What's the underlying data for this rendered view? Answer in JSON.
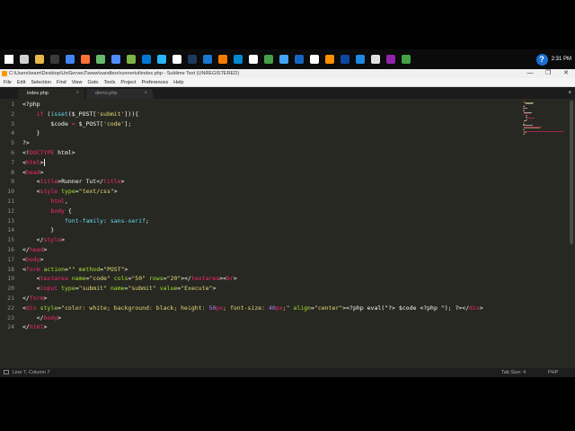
{
  "window": {
    "title": "C:\\Users\\team\\Desktop\\UniServerZ\\www\\sandbox\\runnertut\\index.php - Sublime Text (UNREGISTERED)",
    "controls": [
      "—",
      "❐",
      "✕"
    ]
  },
  "taskbar": {
    "icons": [
      "windows-icon",
      "task-view-icon",
      "file-explorer-icon",
      "terminal-icon",
      "chrome-icon",
      "firefox-icon",
      "app-icon",
      "app-icon",
      "app-icon",
      "app-icon",
      "app-icon",
      "app-icon",
      "steam-icon",
      "app-icon",
      "app-icon",
      "app-icon",
      "app-icon",
      "app-icon",
      "app-icon",
      "app-icon",
      "app-icon",
      "vlc-icon",
      "app-icon",
      "app-icon",
      "app-icon",
      "app-icon",
      "app-icon"
    ],
    "icon_colors": [
      "#ffffff",
      "#d0d0d0",
      "#e8b84a",
      "#3a3a3a",
      "#4285f4",
      "#ff7139",
      "#66bb6a",
      "#4e8cff",
      "#7cb342",
      "#0078d7",
      "#29b6f6",
      "#ffffff",
      "#1e3a5f",
      "#1976d2",
      "#f57c00",
      "#0288d1",
      "#ffffff",
      "#43a047",
      "#42a5f5",
      "#1565c0",
      "#ffffff",
      "#ff8f00",
      "#0d47a1",
      "#1e88e5",
      "#e0e0e0",
      "#8e24aa",
      "#43a047"
    ],
    "tray_time": "2:31 PM"
  },
  "menu": {
    "items": [
      "File",
      "Edit",
      "Selection",
      "Find",
      "View",
      "Goto",
      "Tools",
      "Project",
      "Preferences",
      "Help"
    ]
  },
  "tabs": [
    {
      "label": "index.php",
      "active": true
    },
    {
      "label": "demo.php",
      "active": false
    }
  ],
  "editor": {
    "line_numbers": [
      "1",
      "2",
      "3",
      "4",
      "5",
      "6",
      "7",
      "8",
      "9",
      "10",
      "11",
      "12",
      "13",
      "14",
      "15",
      "16",
      "17",
      "18",
      "19",
      "20",
      "21",
      "22",
      "23",
      "24"
    ],
    "lines": [
      [
        [
          "t",
          "<?php"
        ]
      ],
      [
        [
          "t",
          "    "
        ],
        [
          "k",
          "if"
        ],
        [
          "t",
          " ("
        ],
        [
          "v",
          "isset"
        ],
        [
          "t",
          "($_POST["
        ],
        [
          "s",
          "'submit'"
        ],
        [
          "t",
          "])){"
        ]
      ],
      [
        [
          "t",
          "        $code "
        ],
        [
          "k",
          "="
        ],
        [
          "t",
          " $_POST["
        ],
        [
          "s",
          "'code'"
        ],
        [
          "t",
          "];"
        ]
      ],
      [
        [
          "t",
          "    }"
        ]
      ],
      [
        [
          "t",
          "?>"
        ]
      ],
      [
        [
          "t",
          "<!"
        ],
        [
          "k",
          "DOCTYPE"
        ],
        [
          "t",
          " html>"
        ]
      ],
      [
        [
          "t",
          "<"
        ],
        [
          "k",
          "html"
        ],
        [
          "t",
          ">"
        ],
        [
          "caret",
          ""
        ]
      ],
      [
        [
          "t",
          "<"
        ],
        [
          "k",
          "head"
        ],
        [
          "t",
          ">"
        ]
      ],
      [
        [
          "t",
          "    <"
        ],
        [
          "k",
          "title"
        ],
        [
          "t",
          ">Runner Tut</"
        ],
        [
          "k",
          "title"
        ],
        [
          "t",
          ">"
        ]
      ],
      [
        [
          "t",
          "    <"
        ],
        [
          "k",
          "style"
        ],
        [
          "t",
          " "
        ],
        [
          "a",
          "type"
        ],
        [
          "t",
          "="
        ],
        [
          "s",
          "\"text/css\""
        ],
        [
          "t",
          ">"
        ]
      ],
      [
        [
          "t",
          "        "
        ],
        [
          "k",
          "html"
        ],
        [
          "t",
          ","
        ]
      ],
      [
        [
          "t",
          "        "
        ],
        [
          "k",
          "body"
        ],
        [
          "t",
          " {"
        ]
      ],
      [
        [
          "t",
          "            "
        ],
        [
          "v",
          "font-family"
        ],
        [
          "t",
          ": "
        ],
        [
          "v",
          "sans-serif"
        ],
        [
          "t",
          ";"
        ]
      ],
      [
        [
          "t",
          "        }"
        ]
      ],
      [
        [
          "t",
          "    </"
        ],
        [
          "k",
          "style"
        ],
        [
          "t",
          ">"
        ]
      ],
      [
        [
          "t",
          "</"
        ],
        [
          "k",
          "head"
        ],
        [
          "t",
          ">"
        ]
      ],
      [
        [
          "t",
          "<"
        ],
        [
          "k",
          "body"
        ],
        [
          "t",
          ">"
        ]
      ],
      [
        [
          "t",
          "<"
        ],
        [
          "k",
          "form"
        ],
        [
          "t",
          " "
        ],
        [
          "a",
          "action"
        ],
        [
          "t",
          "="
        ],
        [
          "s",
          "\"\""
        ],
        [
          "t",
          " "
        ],
        [
          "a",
          "method"
        ],
        [
          "t",
          "="
        ],
        [
          "s",
          "\"POST\""
        ],
        [
          "t",
          ">"
        ]
      ],
      [
        [
          "t",
          "    <"
        ],
        [
          "k",
          "textarea"
        ],
        [
          "t",
          " "
        ],
        [
          "a",
          "name"
        ],
        [
          "t",
          "="
        ],
        [
          "s",
          "\"code\""
        ],
        [
          "t",
          " "
        ],
        [
          "a",
          "cols"
        ],
        [
          "t",
          "="
        ],
        [
          "s",
          "\"50\""
        ],
        [
          "t",
          " "
        ],
        [
          "a",
          "rows"
        ],
        [
          "t",
          "="
        ],
        [
          "s",
          "\"20\""
        ],
        [
          "t",
          "></"
        ],
        [
          "k",
          "textarea"
        ],
        [
          "t",
          "><"
        ],
        [
          "k",
          "br"
        ],
        [
          "t",
          ">"
        ]
      ],
      [
        [
          "t",
          "    <"
        ],
        [
          "k",
          "input"
        ],
        [
          "t",
          " "
        ],
        [
          "a",
          "type"
        ],
        [
          "t",
          "="
        ],
        [
          "s",
          "\"submit\""
        ],
        [
          "t",
          " "
        ],
        [
          "a",
          "name"
        ],
        [
          "t",
          "="
        ],
        [
          "s",
          "\"submit\""
        ],
        [
          "t",
          " "
        ],
        [
          "a",
          "value"
        ],
        [
          "t",
          "="
        ],
        [
          "s",
          "\"Execute\""
        ],
        [
          "t",
          ">"
        ]
      ],
      [
        [
          "t",
          "</"
        ],
        [
          "k",
          "form"
        ],
        [
          "t",
          ">"
        ]
      ],
      [
        [
          "t",
          "<"
        ],
        [
          "k",
          "div"
        ],
        [
          "t",
          " "
        ],
        [
          "a",
          "style"
        ],
        [
          "t",
          "="
        ],
        [
          "s",
          "\"color: white; background: black; height: "
        ],
        [
          "n",
          "50"
        ],
        [
          "k",
          "px"
        ],
        [
          "s",
          "; font-size: "
        ],
        [
          "n",
          "40"
        ],
        [
          "k",
          "px"
        ],
        [
          "s",
          ";\""
        ],
        [
          "t",
          " "
        ],
        [
          "a",
          "align"
        ],
        [
          "t",
          "="
        ],
        [
          "s",
          "\"center\""
        ],
        [
          "t",
          ">"
        ],
        [
          "t",
          "<?php eval(\"?> $code <?php \"); ?>"
        ],
        [
          "t",
          "</"
        ],
        [
          "k",
          "div"
        ],
        [
          "t",
          ">"
        ]
      ],
      [
        [
          "t",
          "    </"
        ],
        [
          "k",
          "body"
        ],
        [
          "t",
          ">"
        ]
      ],
      [
        [
          "t",
          "</"
        ],
        [
          "k",
          "html"
        ],
        [
          "t",
          ">"
        ]
      ]
    ]
  },
  "status": {
    "position": "Line 7, Column 7",
    "tab_size": "Tab Size: 4",
    "syntax": "PHP"
  },
  "colors": {
    "editor_bg": "#272822",
    "keyword": "#f92672",
    "string": "#e6db74",
    "attribute": "#a6e22e",
    "number": "#ae81ff",
    "support": "#66d9ef",
    "text": "#f8f8f2",
    "gutter": "#8f908a"
  }
}
